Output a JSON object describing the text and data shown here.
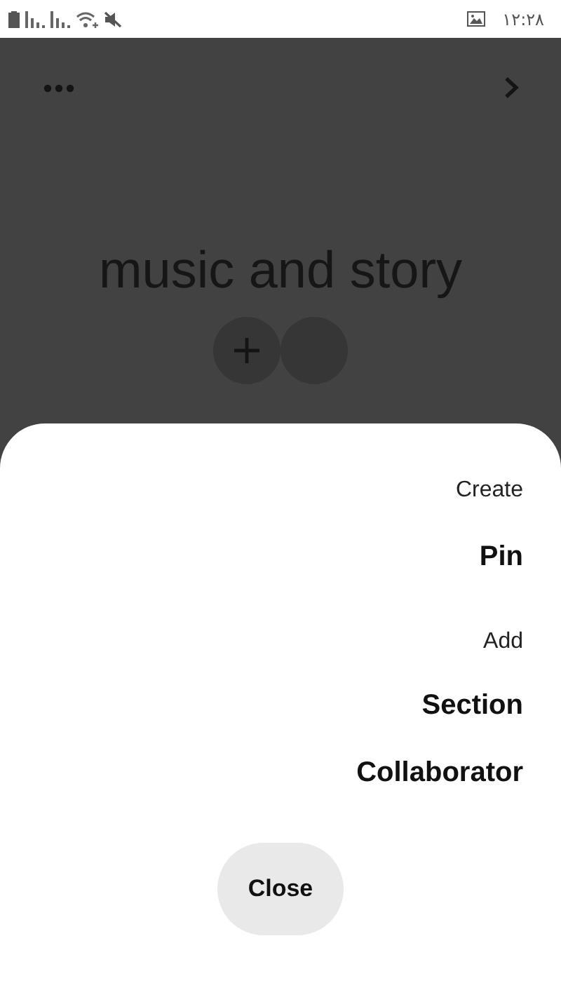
{
  "status_bar": {
    "time": "۱۲:۲۸"
  },
  "board": {
    "title": "music and story"
  },
  "sheet": {
    "groups": [
      {
        "heading": "Create",
        "items": [
          "Pin"
        ]
      },
      {
        "heading": "Add",
        "items": [
          "Section",
          "Collaborator"
        ]
      }
    ],
    "close_button": "Close"
  }
}
